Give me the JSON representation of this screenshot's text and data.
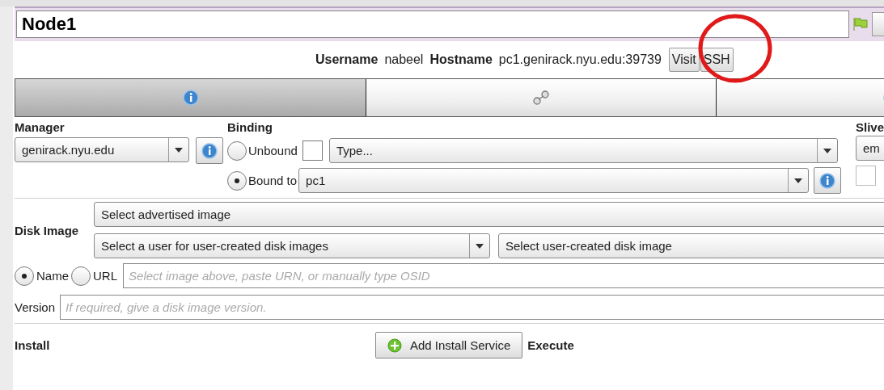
{
  "node": {
    "name": "Node1"
  },
  "host_info": {
    "username_label": "Username",
    "username": "nabeel",
    "hostname_label": "Hostname",
    "hostname": "pc1.genirack.nyu.edu:39739",
    "buttons": [
      "Visit",
      "SSH"
    ]
  },
  "tabs": [
    {
      "selected": true
    },
    {
      "selected": false
    },
    {
      "selected": false
    }
  ],
  "manager": {
    "label": "Manager",
    "value": "genirack.nyu.edu"
  },
  "binding": {
    "label": "Binding",
    "options": [
      {
        "label": "Unbound",
        "selected": false
      },
      {
        "label": "Bound to",
        "selected": true
      }
    ],
    "unbound_checkbox": {
      "checked": false
    },
    "type_value": "Type...",
    "bound_value": "pc1"
  },
  "slivers": {
    "label": "Slive",
    "value": "em",
    "checkbox": {
      "checked": false
    }
  },
  "disk_image": {
    "label": "Disk Image",
    "advertised": "Select advertised image",
    "user_select": "Select a user for user-created disk images",
    "user_image": "Select user-created disk image",
    "modes": [
      {
        "label": "Name",
        "selected": true
      },
      {
        "label": "URL",
        "selected": false
      }
    ],
    "placeholder": "Select image above, paste URN, or manually type OSID"
  },
  "version": {
    "label": "Version",
    "placeholder": "If required, give a disk image version."
  },
  "install": {
    "label": "Install",
    "button": "Add Install Service",
    "execute_label": "Execute"
  },
  "annotation": {
    "kind": "circle",
    "color": "#e01a1a"
  }
}
